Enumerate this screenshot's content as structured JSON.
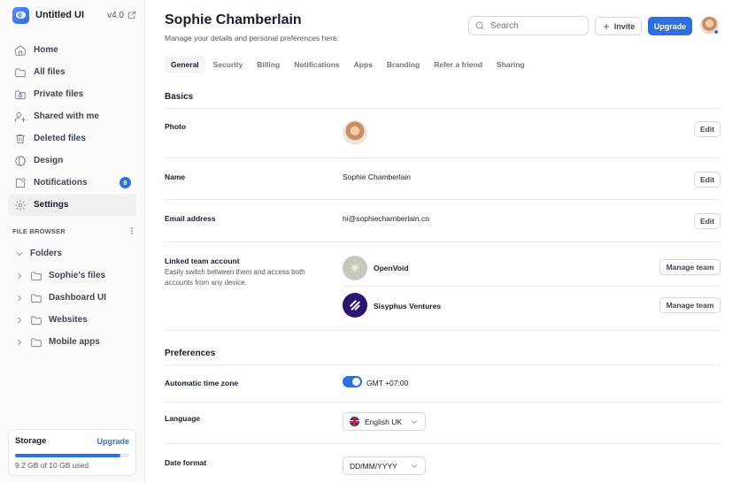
{
  "sidebar": {
    "brand": "Untitled UI",
    "version": "v4.0",
    "nav": [
      {
        "label": "Home",
        "icon": "home-icon"
      },
      {
        "label": "All files",
        "icon": "folder-icon"
      },
      {
        "label": "Private files",
        "icon": "folder-lock-icon"
      },
      {
        "label": "Shared with me",
        "icon": "user-plus-icon"
      },
      {
        "label": "Deleted files",
        "icon": "trash-icon"
      },
      {
        "label": "Design",
        "icon": "design-icon"
      },
      {
        "label": "Notifications",
        "icon": "notification-icon",
        "badge": "8"
      },
      {
        "label": "Settings",
        "icon": "settings-icon",
        "active": true
      }
    ],
    "file_browser_heading": "FILE BROWSER",
    "folders_root": "Folders",
    "folders": [
      "Sophie's files",
      "Dashboard UI",
      "Websites",
      "Mobile apps"
    ],
    "storage": {
      "title": "Storage",
      "upgrade_label": "Upgrade",
      "used_text": "9.2 GB of 10 GB used",
      "used_fraction": 0.92
    }
  },
  "header": {
    "title": "Sophie Chamberlain",
    "subtitle": "Manage your details and personal preferences here.",
    "search_placeholder": "Search",
    "invite_label": "Invite",
    "upgrade_label": "Upgrade"
  },
  "tabs": [
    "General",
    "Security",
    "Billing",
    "Notifications",
    "Apps",
    "Branding",
    "Refer a friend",
    "Sharing"
  ],
  "basics": {
    "heading": "Basics",
    "photo_label": "Photo",
    "photo_edit": "Edit",
    "name_label": "Name",
    "name_value": "Sophie Chamberlain",
    "name_edit": "Edit",
    "email_label": "Email address",
    "email_value": "hi@sophiechamberlain.co",
    "email_edit": "Edit",
    "linked_label": "Linked team account",
    "linked_desc": "Easily switch between them and access both accounts from any device.",
    "teams": [
      {
        "name": "OpenVoid",
        "action": "Manage team"
      },
      {
        "name": "Sisyphus Ventures",
        "action": "Manage team"
      }
    ]
  },
  "preferences": {
    "heading": "Preferences",
    "timezone_label": "Automatic time zone",
    "timezone_value": "GMT +07:00",
    "language_label": "Language",
    "language_value": "English UK",
    "date_label": "Date format",
    "date_value": "DD/MM/YYYY"
  },
  "colors": {
    "accent": "#2f6fe4",
    "openvoid": "#c9c6bd",
    "sisyphus": "#2c1570"
  }
}
